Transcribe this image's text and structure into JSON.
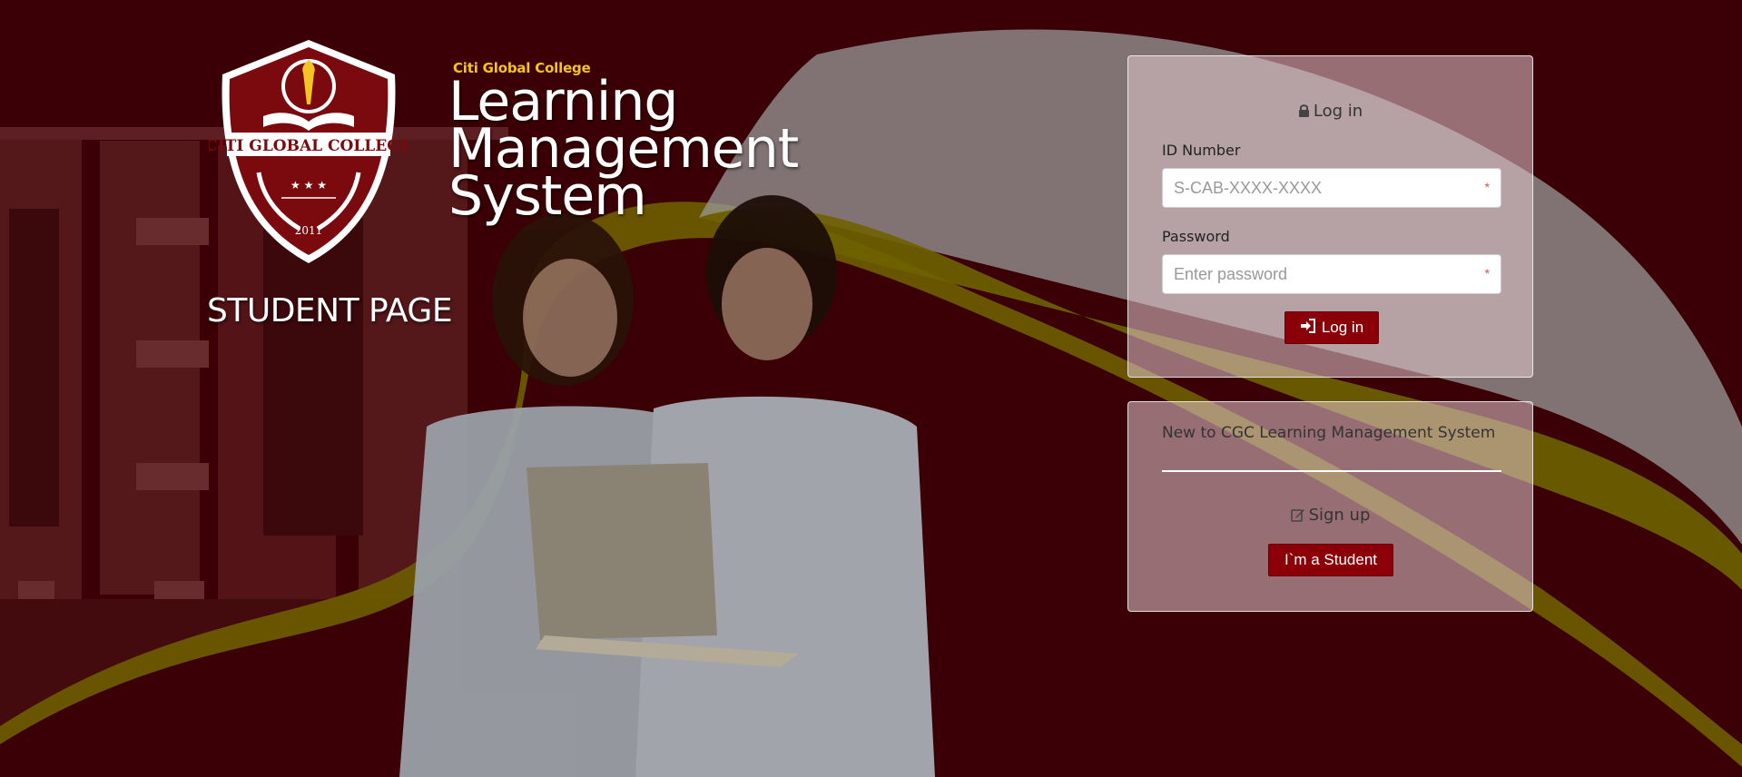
{
  "brand": {
    "college_name": "Citi Global College",
    "system_line1": "Learning",
    "system_line2": "Management",
    "system_line3": "System",
    "page_label": "STUDENT PAGE",
    "logo_text": "CITI GLOBAL COLLEGE",
    "logo_year": "2011"
  },
  "login": {
    "title": "Log in",
    "id_label": "ID Number",
    "id_placeholder": "S-CAB-XXXX-XXXX",
    "id_value": "",
    "password_label": "Password",
    "password_placeholder": "Enter password",
    "password_value": "",
    "required_mark": "*",
    "button_label": "Log in"
  },
  "signup": {
    "prompt": "New to CGC Learning Management System",
    "title": "Sign up",
    "button_label": "I`m a Student"
  },
  "colors": {
    "background": "#3a0005",
    "accent_gold": "#f6c324",
    "button_red": "#8b0008",
    "required_red": "#d9534f"
  }
}
